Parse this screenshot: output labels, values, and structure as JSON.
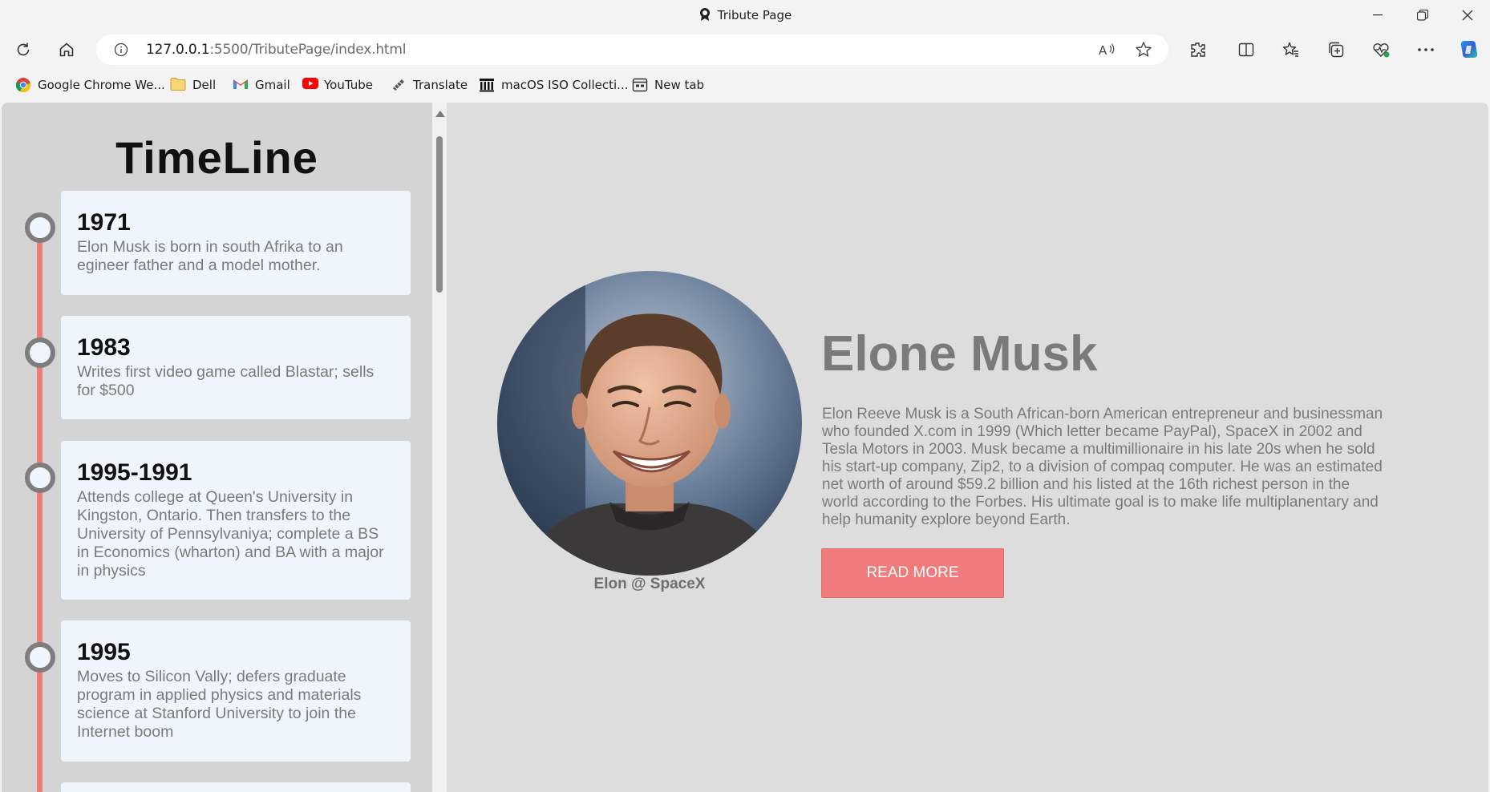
{
  "browser": {
    "tab_title": "Tribute Page",
    "url_host": "127.0.0.1",
    "url_rest": ":5500/TributePage/index.html",
    "icons": [
      "refresh-icon",
      "home-icon",
      "info-icon",
      "read-aloud-icon",
      "favorite-star-icon",
      "extensions-icon",
      "split-screen-icon",
      "favorites-icon",
      "collections-icon",
      "performance-icon",
      "more-icon",
      "copilot-icon"
    ]
  },
  "bookmarks": [
    {
      "label": "Google Chrome We...",
      "icon": "chrome-icon"
    },
    {
      "label": "Dell",
      "icon": "folder-icon"
    },
    {
      "label": "Gmail",
      "icon": "gmail-icon"
    },
    {
      "label": "YouTube",
      "icon": "youtube-icon"
    },
    {
      "label": "Translate",
      "icon": "translate-icon"
    },
    {
      "label": "macOS ISO Collecti...",
      "icon": "archive-icon"
    },
    {
      "label": "New tab",
      "icon": "new-tab-icon"
    }
  ],
  "timeline": {
    "title": "TimeLine",
    "items": [
      {
        "year": "1971",
        "text": "Elon Musk is born in south Afrika to an egineer father and a model mother."
      },
      {
        "year": "1983",
        "text": "Writes first video game called Blastar; sells for $500"
      },
      {
        "year": "1995-1991",
        "text": "Attends college at Queen's University in Kingston, Ontario. Then transfers to the University of Pennsylvaniya; complete a BS in Economics (wharton) and BA with a major in physics"
      },
      {
        "year": "1995",
        "text": "Moves to Silicon Vally; defers graduate program in applied physics and materials science at Stanford University to join the Internet boom"
      }
    ]
  },
  "hero": {
    "caption": "Elon @ SpaceX",
    "name": "Elone Musk",
    "bio": "Elon Reeve Musk is a South African-born American entrepreneur and businessman who founded X.com in 1999 (Which letter became PayPal), SpaceX in 2002 and Tesla Motors in 2003. Musk became a multimillionaire in his late 20s when he sold his start-up company, Zip2, to a division of compaq computer. He was an estimated net worth of around $59.2 billion and his listed at the 16th richest person in the world according to the Forbes. His ultimate goal is to make life multiplanentary and help humanity explore beyond Earth.",
    "button_label": "READ MORE"
  },
  "colors": {
    "accent": "#ef7b7b",
    "card_bg": "#eef5fd",
    "sidebar_bg": "#d4d4d4",
    "page_bg": "#dddddd"
  }
}
